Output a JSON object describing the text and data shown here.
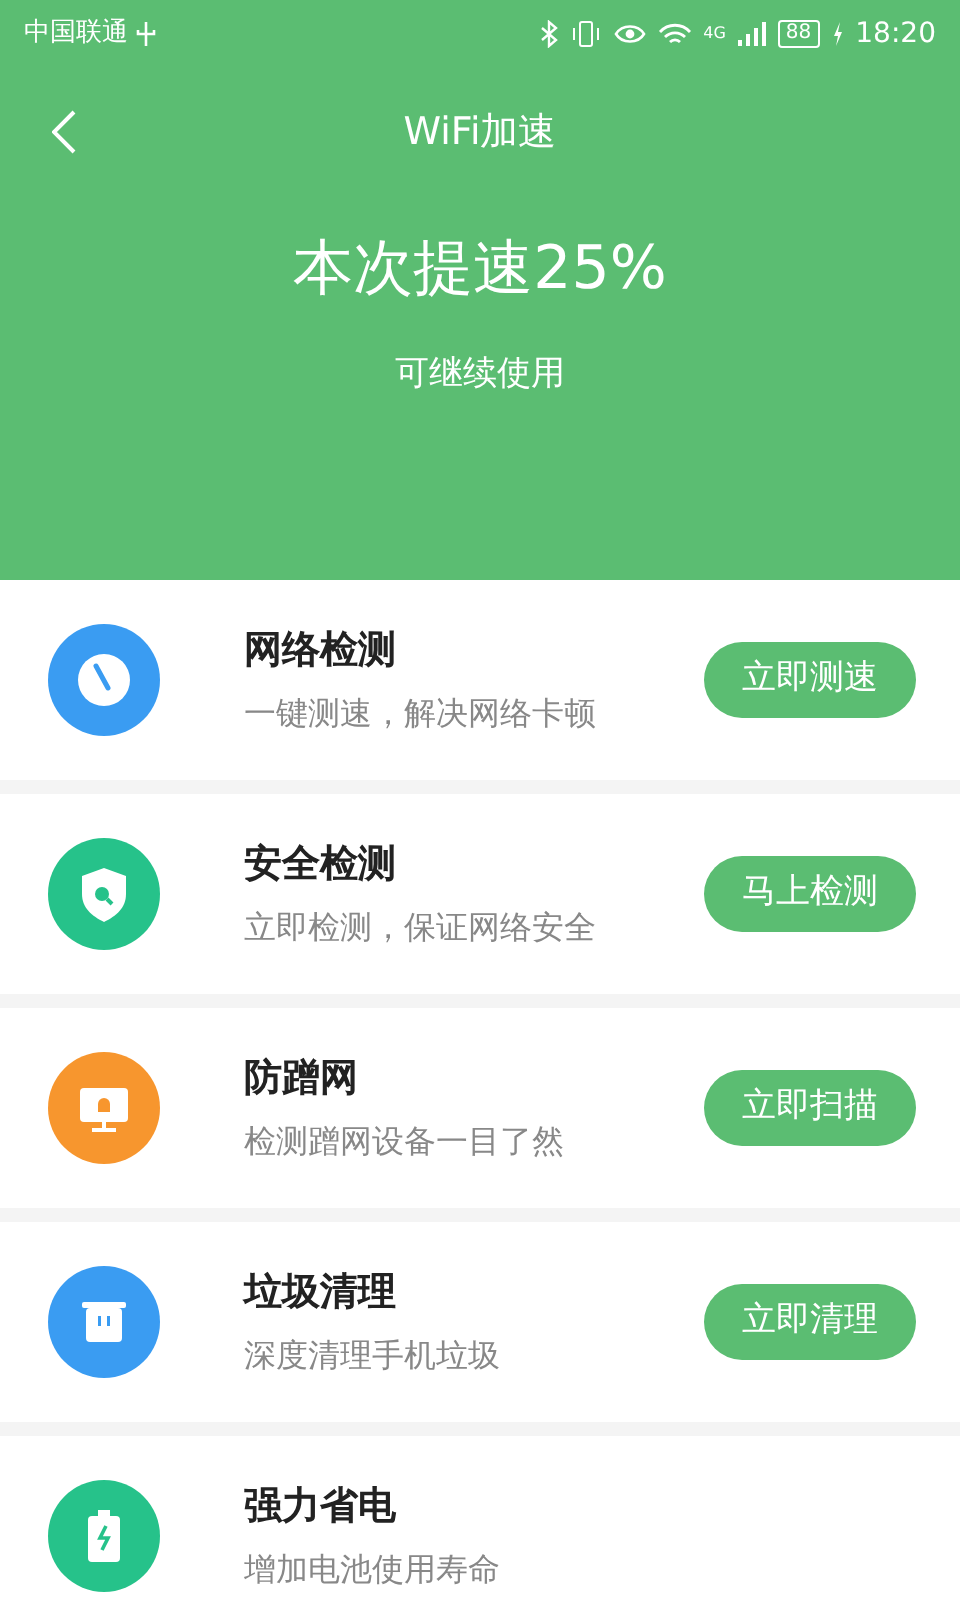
{
  "status_bar": {
    "carrier": "中国联通",
    "network": "4G",
    "battery": "88",
    "time": "18:20"
  },
  "header": {
    "title": "WiFi加速",
    "headline": "本次提速25%",
    "subtitle": "可继续使用"
  },
  "items": [
    {
      "kind": "gauge",
      "color": "#3a9cf2",
      "title": "网络检测",
      "desc": "一键测速，解决网络卡顿",
      "button": "立即测速"
    },
    {
      "kind": "shield",
      "color": "#26c28a",
      "title": "安全检测",
      "desc": "立即检测，保证网络安全",
      "button": "马上检测"
    },
    {
      "kind": "monitor",
      "color": "#f7962e",
      "title": "防蹭网",
      "desc": "检测蹭网设备一目了然",
      "button": "立即扫描"
    },
    {
      "kind": "trash",
      "color": "#3a9cf2",
      "title": "垃圾清理",
      "desc": "深度清理手机垃圾",
      "button": "立即清理"
    },
    {
      "kind": "battery",
      "color": "#26c28a",
      "title": "强力省电",
      "desc": "增加电池使用寿命"
    }
  ]
}
